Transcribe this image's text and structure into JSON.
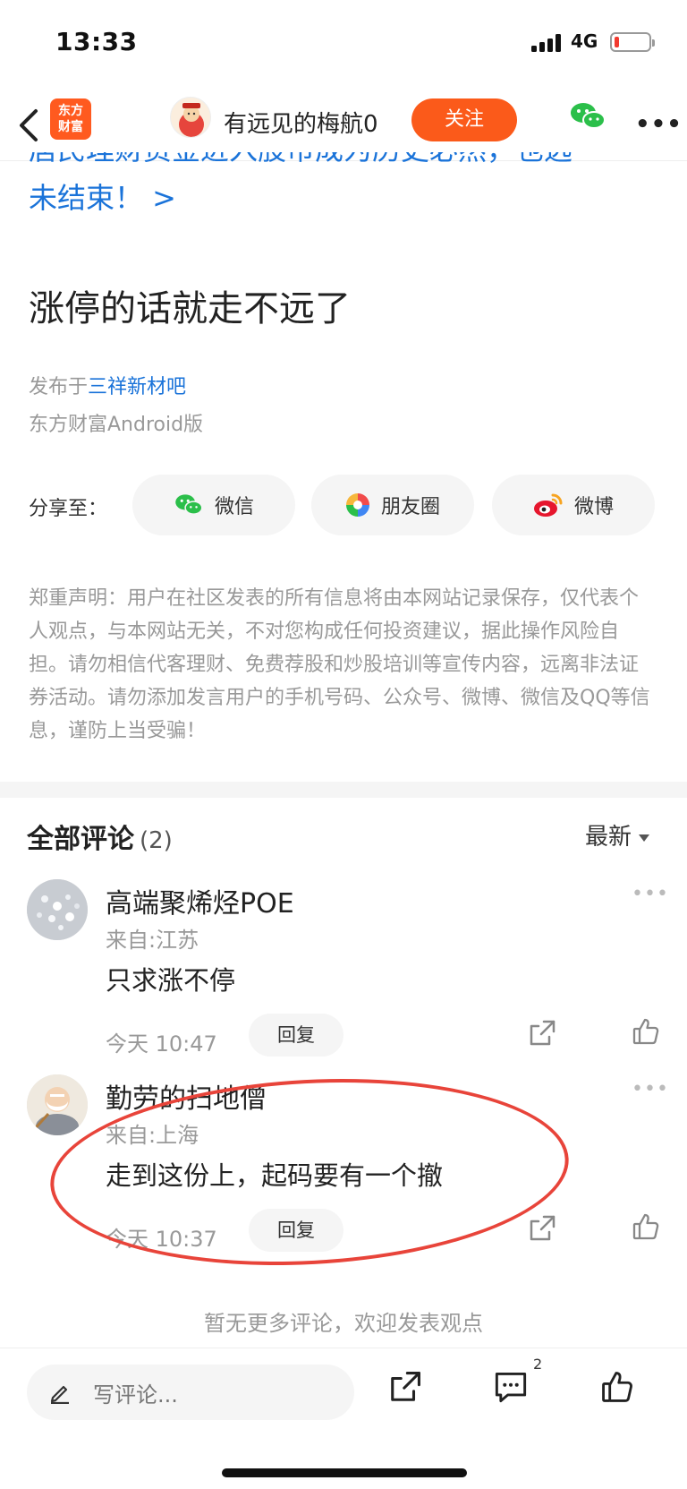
{
  "status_bar": {
    "time": "13:33",
    "network": "4G",
    "battery_level": 0.12,
    "battery_color": "#f23a2f"
  },
  "nav": {
    "app_logo_line1": "东方",
    "app_logo_line2": "财富",
    "author_name": "有远见的梅航0",
    "follow_label": "关注",
    "follow_color": "#fb5a1a"
  },
  "post": {
    "link_title_line1": "居民理财资金进入股市成为历史必然，也远",
    "link_title_line2": "未结束！ >",
    "body": "涨停的话就走不远了",
    "published_prefix": "发布于",
    "published_board": "三祥新材吧",
    "client": "东方财富Android版"
  },
  "share": {
    "label": "分享至：",
    "items": [
      {
        "label": "微信",
        "icon": "wechat-icon"
      },
      {
        "label": "朋友圈",
        "icon": "moments-icon"
      },
      {
        "label": "微博",
        "icon": "weibo-icon"
      }
    ]
  },
  "disclaimer": "郑重声明：用户在社区发表的所有信息将由本网站记录保存，仅代表个人观点，与本网站无关，不对您构成任何投资建议，据此操作风险自担。请勿相信代客理财、免费荐股和炒股培训等宣传内容，远离非法证券活动。请勿添加发言用户的手机号码、公众号、微博、微信及QQ等信息，谨防上当受骗！",
  "comments": {
    "header": "全部评论",
    "count": "(2)",
    "sort_label": "最新",
    "items": [
      {
        "name": "高端聚烯烃POE",
        "location": "来自:江苏",
        "text": "只求涨不停",
        "time": "今天 10:47",
        "reply_label": "回复"
      },
      {
        "name": "勤劳的扫地僧",
        "location": "来自:上海",
        "text": "走到这份上，起码要有一个撤",
        "time": "今天 10:37",
        "reply_label": "回复"
      }
    ],
    "no_more": "暂无更多评论，欢迎发表观点"
  },
  "bottom_bar": {
    "input_placeholder": "写评论...",
    "comment_badge": "2"
  },
  "colors": {
    "accent": "#fb5a1a",
    "link": "#1a73d9",
    "annotation": "#e8443a"
  }
}
